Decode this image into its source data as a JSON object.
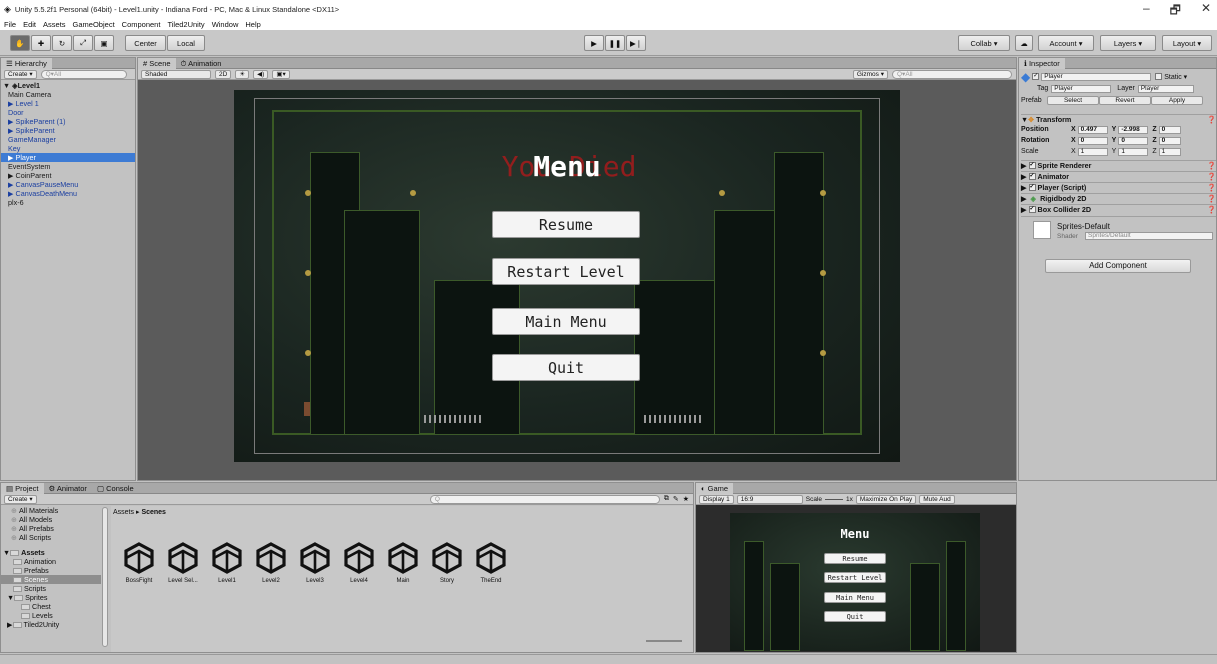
{
  "window": {
    "title": "Unity 5.5.2f1 Personal (64bit) - Level1.unity - Indiana Ford - PC, Mac & Linux Standalone <DX11>",
    "min": "–",
    "max": "🗗",
    "close": "✕"
  },
  "menu": [
    "File",
    "Edit",
    "Assets",
    "GameObject",
    "Component",
    "Tiled2Unity",
    "Window",
    "Help"
  ],
  "toolbar": {
    "center": "Center",
    "local": "Local",
    "collab": "Collab ▾",
    "account": "Account ▾",
    "layers": "Layers ▾",
    "layout": "Layout ▾"
  },
  "hierarchy": {
    "tab": "Hierarchy",
    "create": "Create ▾",
    "search": "Q▾All",
    "scene": "Level1",
    "items": [
      {
        "label": "Main Camera",
        "cls": "",
        "lvl": 1
      },
      {
        "label": "▶ Level 1",
        "cls": "blue",
        "lvl": 1
      },
      {
        "label": "Door",
        "cls": "blue",
        "lvl": 1
      },
      {
        "label": "▶ SpikeParent (1)",
        "cls": "blue",
        "lvl": 1
      },
      {
        "label": "▶ SpikeParent",
        "cls": "blue",
        "lvl": 1
      },
      {
        "label": "GameManager",
        "cls": "blue",
        "lvl": 1
      },
      {
        "label": "Key",
        "cls": "blue",
        "lvl": 1
      },
      {
        "label": "▶ Player",
        "cls": "sel",
        "lvl": 1
      },
      {
        "label": "EventSystem",
        "cls": "",
        "lvl": 1
      },
      {
        "label": "▶ CoinParent",
        "cls": "",
        "lvl": 1
      },
      {
        "label": "▶ CanvasPauseMenu",
        "cls": "blue",
        "lvl": 1
      },
      {
        "label": "▶ CanvasDeathMenu",
        "cls": "blue",
        "lvl": 1
      },
      {
        "label": "plx-6",
        "cls": "",
        "lvl": 1
      }
    ]
  },
  "scene": {
    "tab_scene": "Scene",
    "tab_animation": "Animation",
    "shaded": "Shaded",
    "mode2d": "2D",
    "gizmos": "Gizmos ▾",
    "search": "Q▾All"
  },
  "menu_overlay": {
    "title": "Menu",
    "ghost": "You Died",
    "buttons": [
      "Resume",
      "Restart Level",
      "Main Menu",
      "Quit"
    ]
  },
  "inspector": {
    "tab": "Inspector",
    "name": "Player",
    "static": "Static ▾",
    "tag_label": "Tag",
    "tag": "Player",
    "layer_label": "Layer",
    "layer": "Player",
    "prefab": "Prefab",
    "select": "Select",
    "revert": "Revert",
    "apply": "Apply",
    "transform": {
      "title": "Transform",
      "position": "Position",
      "rotation": "Rotation",
      "scale": "Scale",
      "pos": [
        "0.497",
        "-2.998",
        "0"
      ],
      "rot": [
        "0",
        "0",
        "0"
      ],
      "scl": [
        "1",
        "1",
        "1"
      ],
      "x": "X",
      "y": "Y",
      "z": "Z"
    },
    "components": [
      "Sprite Renderer",
      "Animator",
      "Player (Script)",
      "Rigidbody 2D",
      "Box Collider 2D"
    ],
    "material": "Sprites-Default",
    "shader_label": "Shader",
    "shader": "Sprites/Default",
    "add": "Add Component"
  },
  "project": {
    "tab_project": "Project",
    "tab_animator": "Animator",
    "tab_console": "Console",
    "create": "Create ▾",
    "breadcrumb_root": "Assets",
    "breadcrumb_sep": "▸",
    "breadcrumb_cur": "Scenes",
    "favorites": [
      "All Materials",
      "All Models",
      "All Prefabs",
      "All Scripts"
    ],
    "assets_root": "Assets",
    "folders": [
      "Animation",
      "Prefabs",
      "Scenes",
      "Scripts",
      "Sprites",
      "Chest",
      "Levels",
      "Tiled2Unity"
    ],
    "scenes": [
      "BossFight",
      "Level Sel...",
      "Level1",
      "Level2",
      "Level3",
      "Level4",
      "Main",
      "Story",
      "TheEnd"
    ]
  },
  "game": {
    "tab": "Game",
    "display": "Display 1",
    "aspect": "16:9",
    "scale_label": "Scale",
    "scale": "1x",
    "maximize": "Maximize On Play",
    "mute": "Mute Aud"
  }
}
